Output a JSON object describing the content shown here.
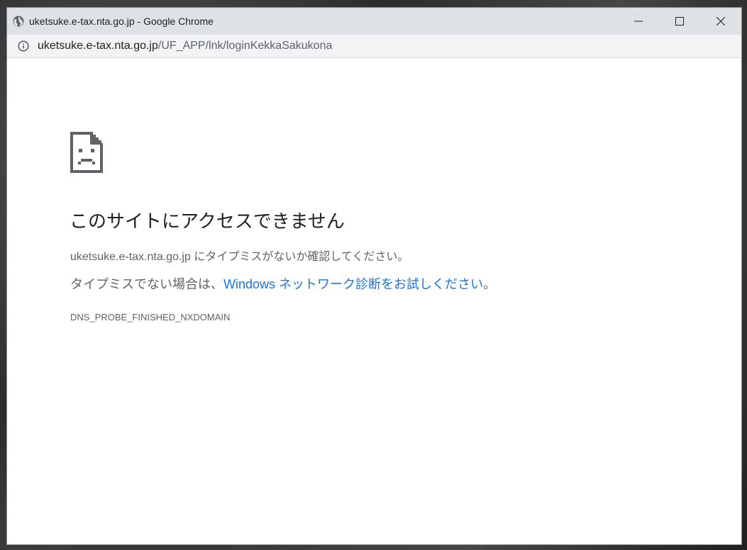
{
  "window": {
    "title": "uketsuke.e-tax.nta.go.jp - Google Chrome"
  },
  "address_bar": {
    "url_host": "uketsuke.e-tax.nta.go.jp",
    "url_path": "/UF_APP/lnk/loginKekkaSakukona"
  },
  "error_page": {
    "heading": "このサイトにアクセスできません",
    "line1": "uketsuke.e-tax.nta.go.jp にタイプミスがないか確認してください。",
    "line2_prefix": "タイプミスでない場合は、",
    "line2_link": "Windows ネットワーク診断をお試しください",
    "line2_suffix": "。",
    "error_code": "DNS_PROBE_FINISHED_NXDOMAIN"
  },
  "icons": {
    "title": "globe-icon",
    "address": "info-icon",
    "error": "sad-page-icon",
    "minimize": "minimize-icon",
    "maximize": "maximize-icon",
    "close": "close-icon"
  },
  "colors": {
    "titlebar": "#dee1e6",
    "addressbar": "#f1f3f4",
    "link": "#1a73e8",
    "text_primary": "#202124",
    "text_secondary": "#5f6368"
  }
}
